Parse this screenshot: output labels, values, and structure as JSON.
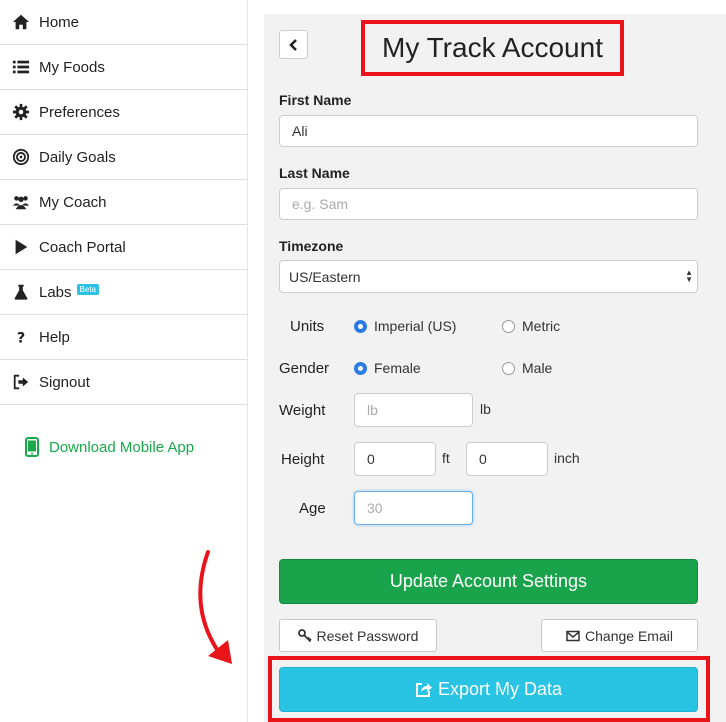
{
  "sidebar": {
    "items": [
      {
        "label": "Home",
        "icon": "home-icon"
      },
      {
        "label": "My Foods",
        "icon": "list-icon"
      },
      {
        "label": "Preferences",
        "icon": "gear-icon"
      },
      {
        "label": "Daily Goals",
        "icon": "target-icon"
      },
      {
        "label": "My Coach",
        "icon": "users-icon"
      },
      {
        "label": "Coach Portal",
        "icon": "play-icon"
      },
      {
        "label": "Labs",
        "icon": "flask-icon",
        "badge": "Beta"
      },
      {
        "label": "Help",
        "icon": "question-icon"
      },
      {
        "label": "Signout",
        "icon": "signout-icon"
      }
    ],
    "download_label": "Download Mobile App"
  },
  "account": {
    "title": "My Track Account",
    "first_name_label": "First Name",
    "first_name_value": "Ali",
    "last_name_label": "Last Name",
    "last_name_placeholder": "e.g. Sam",
    "timezone_label": "Timezone",
    "timezone_value": "US/Eastern",
    "units_label": "Units",
    "units_options": [
      "Imperial (US)",
      "Metric"
    ],
    "units_selected": "Imperial (US)",
    "gender_label": "Gender",
    "gender_options": [
      "Female",
      "Male"
    ],
    "gender_selected": "Female",
    "weight_label": "Weight",
    "weight_placeholder": "lb",
    "weight_unit": "lb",
    "height_label": "Height",
    "height_ft_value": "0",
    "height_ft_unit": "ft",
    "height_in_value": "0",
    "height_in_unit": "inch",
    "age_label": "Age",
    "age_placeholder": "30",
    "update_button": "Update Account Settings",
    "reset_password_button": "Reset Password",
    "change_email_button": "Change Email",
    "export_button": "Export My Data"
  },
  "colors": {
    "highlight": "#e8141a",
    "green": "#19a34a",
    "cyan": "#29c3e3",
    "radio_on": "#2b7be4"
  }
}
